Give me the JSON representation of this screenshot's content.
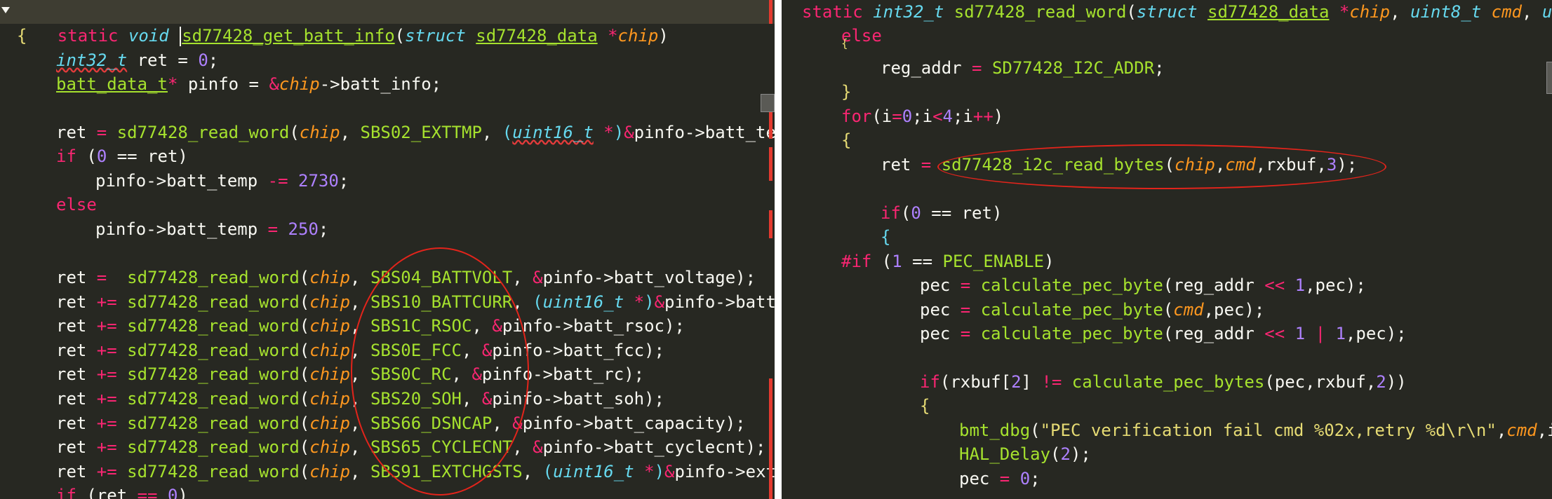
{
  "left_editor": {
    "line1": {
      "kw": "static",
      "typ": "void",
      "fn": "sd77428_get_batt_info",
      "open": "(",
      "kw2": "struct",
      "tname": "sd77428_data",
      "star": " *",
      "prm": "chip",
      "close": ")"
    },
    "line2": {
      "text": "{"
    },
    "line3": {
      "typ": "int32_t",
      "rest": " ret = ",
      "num": "0",
      "semi": ";"
    },
    "line4": {
      "typ": "batt_data_t",
      "kw": "*",
      "id": " pinfo = ",
      "amp": "&",
      "prm": "chip",
      "rest": "->batt_info;"
    },
    "line6": {
      "a": "ret ",
      "eq": "=",
      "sp": " ",
      "fn": "sd77428_read_word",
      "op": "(",
      "prm": "chip",
      "c": ", ",
      "cst": "SBS02_EXTTMP",
      "c2": ", ",
      "op2": "(",
      "typ": "uint16_t",
      "st": " *",
      "cp": ")",
      "amp": "&",
      "rest": "pinfo->batt_temp"
    },
    "line7": {
      "kw": "if",
      "a": " (",
      "num": "0",
      "eqeq": " == ",
      "b": "ret)"
    },
    "line8": {
      "a": "pinfo->batt_temp ",
      "op": "-=",
      "sp": " ",
      "num": "2730",
      "semi": ";"
    },
    "line9": {
      "kw": "else"
    },
    "line10": {
      "a": "pinfo->batt_temp ",
      "op": "=",
      "sp": " ",
      "num": "250",
      "semi": ";"
    },
    "calls": [
      {
        "op": "=  ",
        "reg": "SBS04_BATTVOLT",
        "cast": "",
        "field": "pinfo->batt_voltage",
        "end": ");"
      },
      {
        "op": "+= ",
        "reg": "SBS10_BATTCURR",
        "cast": "uint16_t",
        "field": "pinfo->batt_c",
        "end": ""
      },
      {
        "op": "+= ",
        "reg": "SBS1C_RSOC",
        "cast": "",
        "field": "pinfo->batt_rsoc",
        "end": ");"
      },
      {
        "op": "+= ",
        "reg": "SBS0E_FCC",
        "cast": "",
        "field": "pinfo->batt_fcc",
        "end": ");"
      },
      {
        "op": "+= ",
        "reg": "SBS0C_RC",
        "cast": "",
        "field": "pinfo->batt_rc",
        "end": ");"
      },
      {
        "op": "+= ",
        "reg": "SBS20_SOH",
        "cast": "",
        "field": "pinfo->batt_soh",
        "end": ");"
      },
      {
        "op": "+= ",
        "reg": "SBS66_DSNCAP",
        "cast": "",
        "field": "pinfo->batt_capacity",
        "end": ");"
      },
      {
        "op": "+= ",
        "reg": "SBS65_CYCLECNT",
        "cast": "",
        "field": "pinfo->batt_cyclecnt",
        "end": ");"
      },
      {
        "op": "+= ",
        "reg": "SBS91_EXTCHGSTS",
        "cast": "uint16_t",
        "field": "pinfo->ext_c",
        "end": ""
      }
    ],
    "call_parts": {
      "ret": "ret ",
      "fn": "sd77428_read_word",
      "open": "(",
      "prm": "chip",
      "comma": ", ",
      "amp": "&",
      "star": " *",
      "close": ")"
    },
    "last_line": {
      "kw": "if",
      "a": " (ret ",
      "op": "==",
      "sp": " ",
      "num": "0",
      "b": ")"
    }
  },
  "right_editor": {
    "sig": {
      "kw": "static",
      "typ": "int32_t",
      "fn": "sd77428_read_word",
      "open": "(",
      "kw2": "struct",
      "tname": "sd77428_data",
      "star": " *",
      "prm": "chip",
      "c1": ", ",
      "typ2": "uint8_t",
      "sp": " ",
      "prm2": "cmd",
      "c2": ", ",
      "typ3": "uir"
    },
    "else": "else",
    "top_brace": "{",
    "reg_addr": {
      "a": "reg_addr ",
      "op": "=",
      "sp": " ",
      "cst": "SD77428_I2C_ADDR",
      "semi": ";"
    },
    "close1": "}",
    "for": {
      "kw": "for",
      "a": "(i",
      "eq": "=",
      "n0": "0",
      "b": ";i",
      "lt": "<",
      "n4": "4",
      "c": ";i",
      "pp": "++",
      "d": ")"
    },
    "open2": "{",
    "read_bytes": {
      "a": "ret ",
      "op": "=",
      "sp": " ",
      "fn": "sd77428_i2c_read_bytes",
      "open": "(",
      "prm": "chip",
      "c1": ",",
      "prm2": "cmd",
      "c2": ",rxbuf,",
      "num": "3",
      "close": ");"
    },
    "if_ret": {
      "kw": "if",
      "a": "(",
      "num": "0",
      "eqeq": " == ",
      "b": "ret)"
    },
    "open3": "{",
    "hash_if": {
      "kw": "#if",
      "a": " (",
      "num": "1",
      "eqeq": " == ",
      "cst": "PEC_ENABLE",
      "b": ")"
    },
    "pec1": {
      "a": "pec ",
      "op": "=",
      "sp": " ",
      "fn": "calculate_pec_byte",
      "b": "(reg_addr ",
      "sh": "<<",
      "sp2": " ",
      "num": "1",
      "c": ",pec);"
    },
    "pec2": {
      "a": "pec ",
      "op": "=",
      "sp": " ",
      "fn": "calculate_pec_byte",
      "b": "(",
      "prm": "cmd",
      "c": ",pec);"
    },
    "pec3": {
      "a": "pec ",
      "op": "=",
      "sp": " ",
      "fn": "calculate_pec_byte",
      "b": "(reg_addr ",
      "sh": "<<",
      "sp2": " ",
      "num": "1",
      "sp3": " ",
      "bor": "|",
      "sp4": " ",
      "num2": "1",
      "c": ",pec);"
    },
    "if_rx": {
      "kw": "if",
      "a": "(rxbuf[",
      "num": "2",
      "b": "] ",
      "ne": "!=",
      "sp": " ",
      "fn": "calculate_pec_bytes",
      "c": "(pec,rxbuf,",
      "num2": "2",
      "d": "))"
    },
    "open4": "{",
    "dbg": {
      "fn": "bmt_dbg",
      "a": "(",
      "str": "\"PEC verification fail cmd %02x,retry %d\\r\\n\"",
      "c1": ",",
      "prm": "cmd",
      "c2": ",i)"
    },
    "delay": {
      "fn": "HAL_Delay",
      "a": "(",
      "num": "2",
      "b": ");"
    },
    "pec0": {
      "a": "pec ",
      "op": "=",
      "sp": " ",
      "num": "0",
      "b": ";"
    }
  },
  "colors": {
    "background": "#272822",
    "keyword": "#f92672",
    "type": "#66d9ef",
    "function": "#a6e22e",
    "param": "#fd971f",
    "number": "#ae81ff",
    "string": "#e6db74",
    "annotation": "#e3241b"
  }
}
